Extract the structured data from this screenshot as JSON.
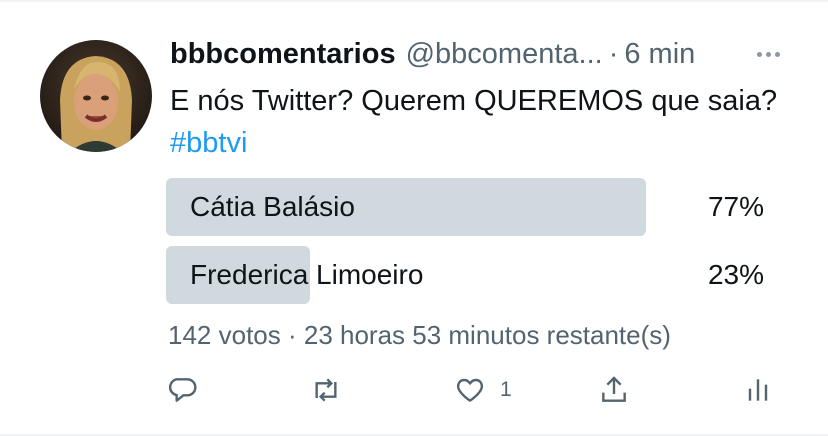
{
  "tweet": {
    "display_name": "bbbcomentarios",
    "handle": "@bbcomenta...",
    "separator": "·",
    "time": "6 min",
    "text_main": "E nós Twitter? Querem QUEREMOS que saia?",
    "hashtag": "#bbtvi"
  },
  "poll": {
    "options": [
      {
        "label": "Cátia Balásio",
        "percent_text": "77%",
        "percent": 77
      },
      {
        "label": "Frederica Limoeiro",
        "percent_text": "23%",
        "percent": 23
      }
    ],
    "meta": "142 votos · 23 horas 53 minutos restante(s)"
  },
  "actions": {
    "like_count": "1"
  },
  "icons": {
    "reply": "reply-icon",
    "retweet": "retweet-icon",
    "like": "heart-icon",
    "share": "share-icon",
    "analytics": "analytics-icon",
    "more": "more-icon"
  },
  "colors": {
    "text": "#0f1419",
    "secondary": "#536471",
    "link": "#1d9bf0",
    "poll_fill": "#cfd9de"
  }
}
